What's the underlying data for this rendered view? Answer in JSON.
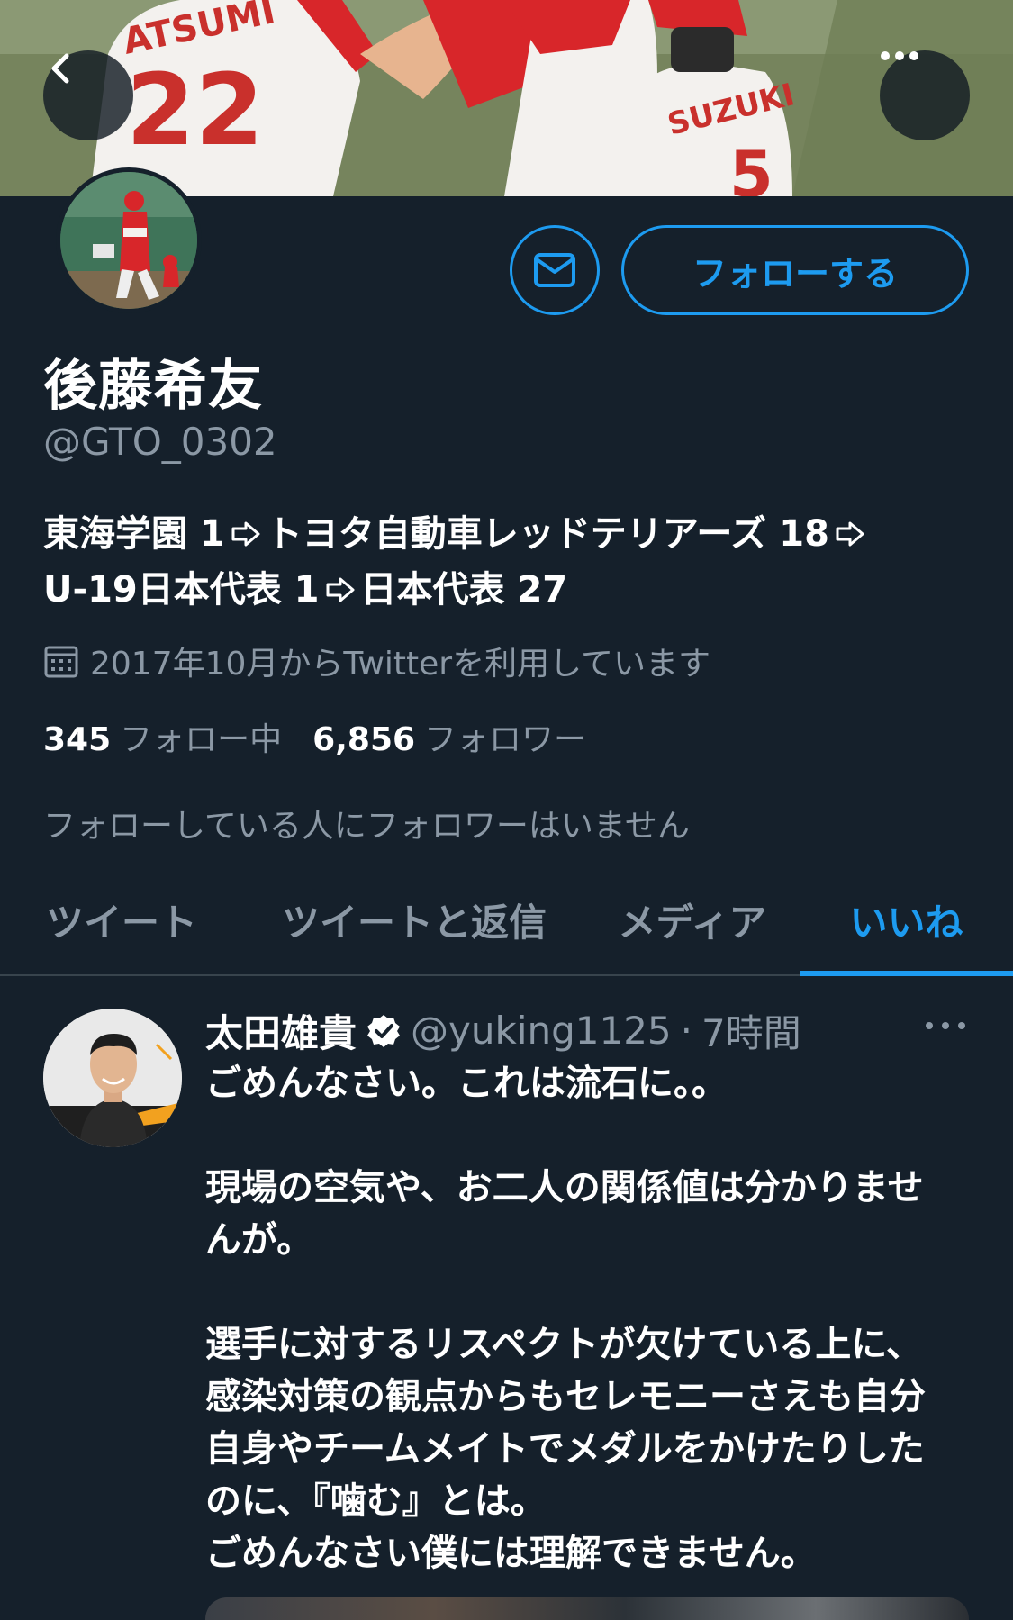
{
  "profile": {
    "display_name": "後藤希友",
    "handle": "@GTO_0302",
    "follow_label": "フォローする",
    "bio_line1": [
      {
        "text": "東海学園 1"
      },
      {
        "text": "トヨタ自動車レッドテリアーズ 18"
      }
    ],
    "bio_line2": [
      {
        "text": "U-19日本代表 1"
      },
      {
        "text": "日本代表 27"
      }
    ],
    "joined": "2017年10月からTwitterを利用しています",
    "following_count": "345",
    "following_label": "フォロー中",
    "followers_count": "6,856",
    "followers_label": "フォロワー",
    "no_mutual_followers": "フォローしている人にフォロワーはいません"
  },
  "banner": {
    "jersey_name_left": "ATSUMI",
    "jersey_number_left": "22",
    "jersey_name_right": "SUZUKI",
    "jersey_number_right": "5"
  },
  "tabs": [
    {
      "label": "ツイート",
      "active": false
    },
    {
      "label": "ツイートと返信",
      "active": false
    },
    {
      "label": "メディア",
      "active": false
    },
    {
      "label": "いいね",
      "active": true
    }
  ],
  "tweet": {
    "author": "太田雄貴",
    "verified": true,
    "handle": "@yuking1125",
    "separator": "·",
    "time": "7時間",
    "paragraphs": [
      [
        "ごめんなさい。これは流石に。。"
      ],
      [
        "現場の空気や、お二人の関係値は分かりませ",
        "んが。"
      ],
      [
        "選手に対するリスペクトが欠けている上に、",
        "感染対策の観点からもセレモニーさえも自分",
        "自身やチームメイトでメダルをかけたりした",
        "のに、『噛む』とは。",
        "ごめんなさい僕には理解できません。"
      ]
    ]
  },
  "colors": {
    "background": "#15202b",
    "accent": "#1d9bf0",
    "secondary_text": "#8b98a5",
    "divider": "#38444d"
  },
  "icons": {
    "back": "chevron-left-icon",
    "more": "more-horizontal-icon",
    "message": "envelope-icon",
    "calendar": "calendar-icon",
    "verified": "verified-badge-icon",
    "bio_arrow": "right-arrow-icon"
  }
}
